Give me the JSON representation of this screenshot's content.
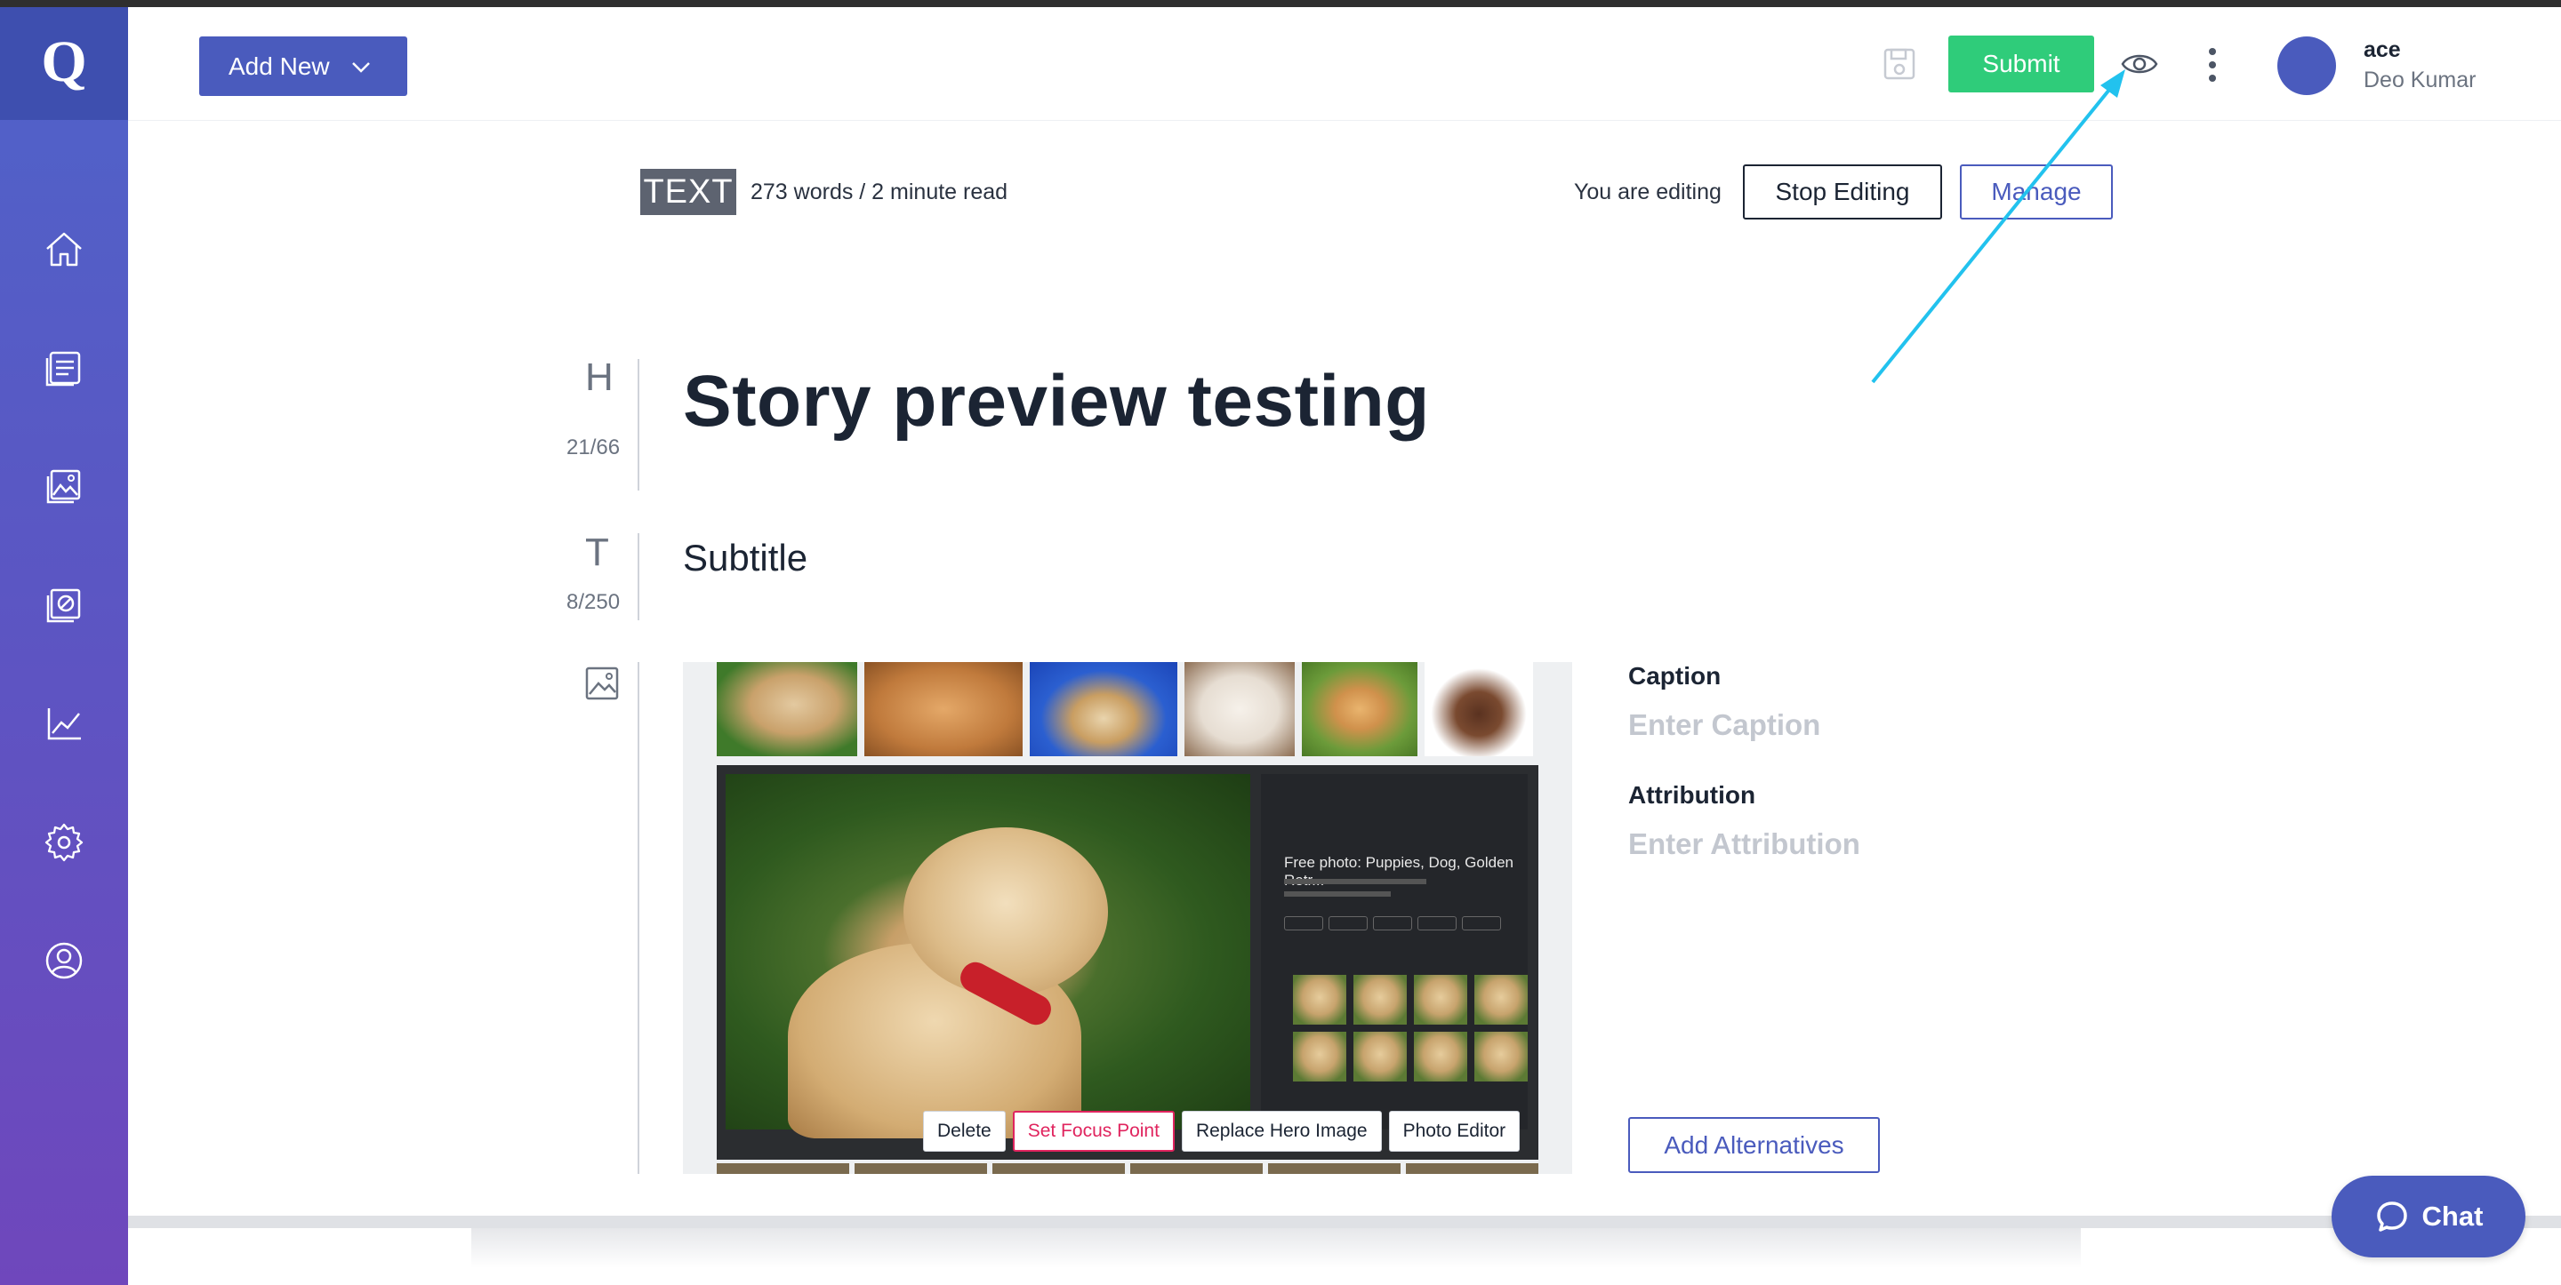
{
  "sidebar": {
    "logo_letter": "Q",
    "items": [
      {
        "name": "home-icon"
      },
      {
        "name": "stories-icon"
      },
      {
        "name": "media-icon"
      },
      {
        "name": "no-image-icon"
      },
      {
        "name": "analytics-icon"
      },
      {
        "name": "settings-icon"
      },
      {
        "name": "user-profile-icon"
      }
    ]
  },
  "header": {
    "add_new_label": "Add New",
    "submit_label": "Submit",
    "user": {
      "username": "ace",
      "full_name": "Deo Kumar"
    }
  },
  "meta": {
    "story_type_badge": "TEXT",
    "word_count": "273 words / 2 minute read",
    "editing_label": "You are editing",
    "stop_editing_label": "Stop Editing",
    "manage_label": "Manage"
  },
  "editor": {
    "headline_marker": "H",
    "headline_count": "21/66",
    "headline": "Story preview testing",
    "subtitle_marker": "T",
    "subtitle_count": "8/250",
    "subtitle": "Subtitle"
  },
  "hero_image": {
    "embedded_title": "Free photo: Puppies, Dog, Golden Retr...",
    "actions": {
      "delete": "Delete",
      "focus": "Set Focus Point",
      "replace": "Replace Hero Image",
      "photo_editor": "Photo Editor"
    },
    "caption_label": "Caption",
    "caption_placeholder": "Enter Caption",
    "attribution_label": "Attribution",
    "attribution_placeholder": "Enter Attribution",
    "add_alternatives_label": "Add Alternatives"
  },
  "chat": {
    "label": "Chat"
  },
  "colors": {
    "brand": "#4a5bbd",
    "submit": "#2fcc7a",
    "danger": "#e0245e",
    "annotation_arrow": "#22c2ee"
  }
}
